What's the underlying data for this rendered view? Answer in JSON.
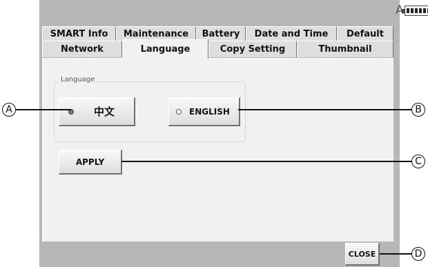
{
  "status": {
    "letter": "A"
  },
  "tabs": {
    "row1": [
      "SMART Info",
      "Maintenance",
      "Battery",
      "Date and Time",
      "Default"
    ],
    "row2": [
      "Network",
      "Language",
      "Copy Setting",
      "Thumbnail"
    ],
    "active": "Language"
  },
  "language_group": {
    "label": "Language",
    "options": [
      {
        "label": "中文",
        "selected": true
      },
      {
        "label": "ENGLISH",
        "selected": false
      }
    ]
  },
  "apply_button": {
    "label": "APPLY"
  },
  "close_button": {
    "label": "CLOSE"
  },
  "callouts": {
    "a": "A",
    "b": "B",
    "c": "C",
    "d": "D"
  },
  "colors": {
    "device_background": "#b7b7b7",
    "panel_background": "#f1f1f1",
    "tab_background": "#dedede"
  }
}
